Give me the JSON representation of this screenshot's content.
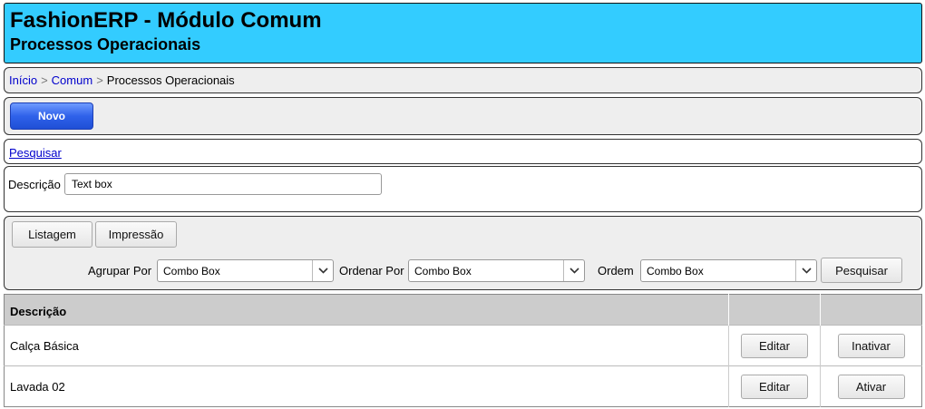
{
  "header": {
    "title": "FashionERP - Módulo Comum",
    "subtitle": "Processos Operacionais",
    "background_color": "#33ccff"
  },
  "breadcrumb": {
    "home": "Início",
    "module": "Comum",
    "current": "Processos Operacionais",
    "separator": ">"
  },
  "toolbar": {
    "new_label": "Novo",
    "accent_color": "#2f62ea"
  },
  "search": {
    "toggle_label": "Pesquisar"
  },
  "filters": {
    "description_label": "Descrição",
    "description_value": "Text box"
  },
  "list_options": {
    "tab_listing": "Listagem",
    "tab_print": "Impressão",
    "group_by_label": "Agrupar Por",
    "group_by_value": "Combo Box",
    "order_by_label": "Ordenar Por",
    "order_by_value": "Combo Box",
    "order_label": "Ordem",
    "order_value": "Combo Box",
    "search_button": "Pesquisar",
    "dropdown_icon": "chevron-down-icon"
  },
  "table": {
    "columns": [
      "Descrição",
      "",
      ""
    ],
    "rows": [
      {
        "description": "Calça Básica",
        "edit": "Editar",
        "toggle": "Inativar"
      },
      {
        "description": "Lavada 02",
        "edit": "Editar",
        "toggle": "Ativar"
      }
    ]
  }
}
